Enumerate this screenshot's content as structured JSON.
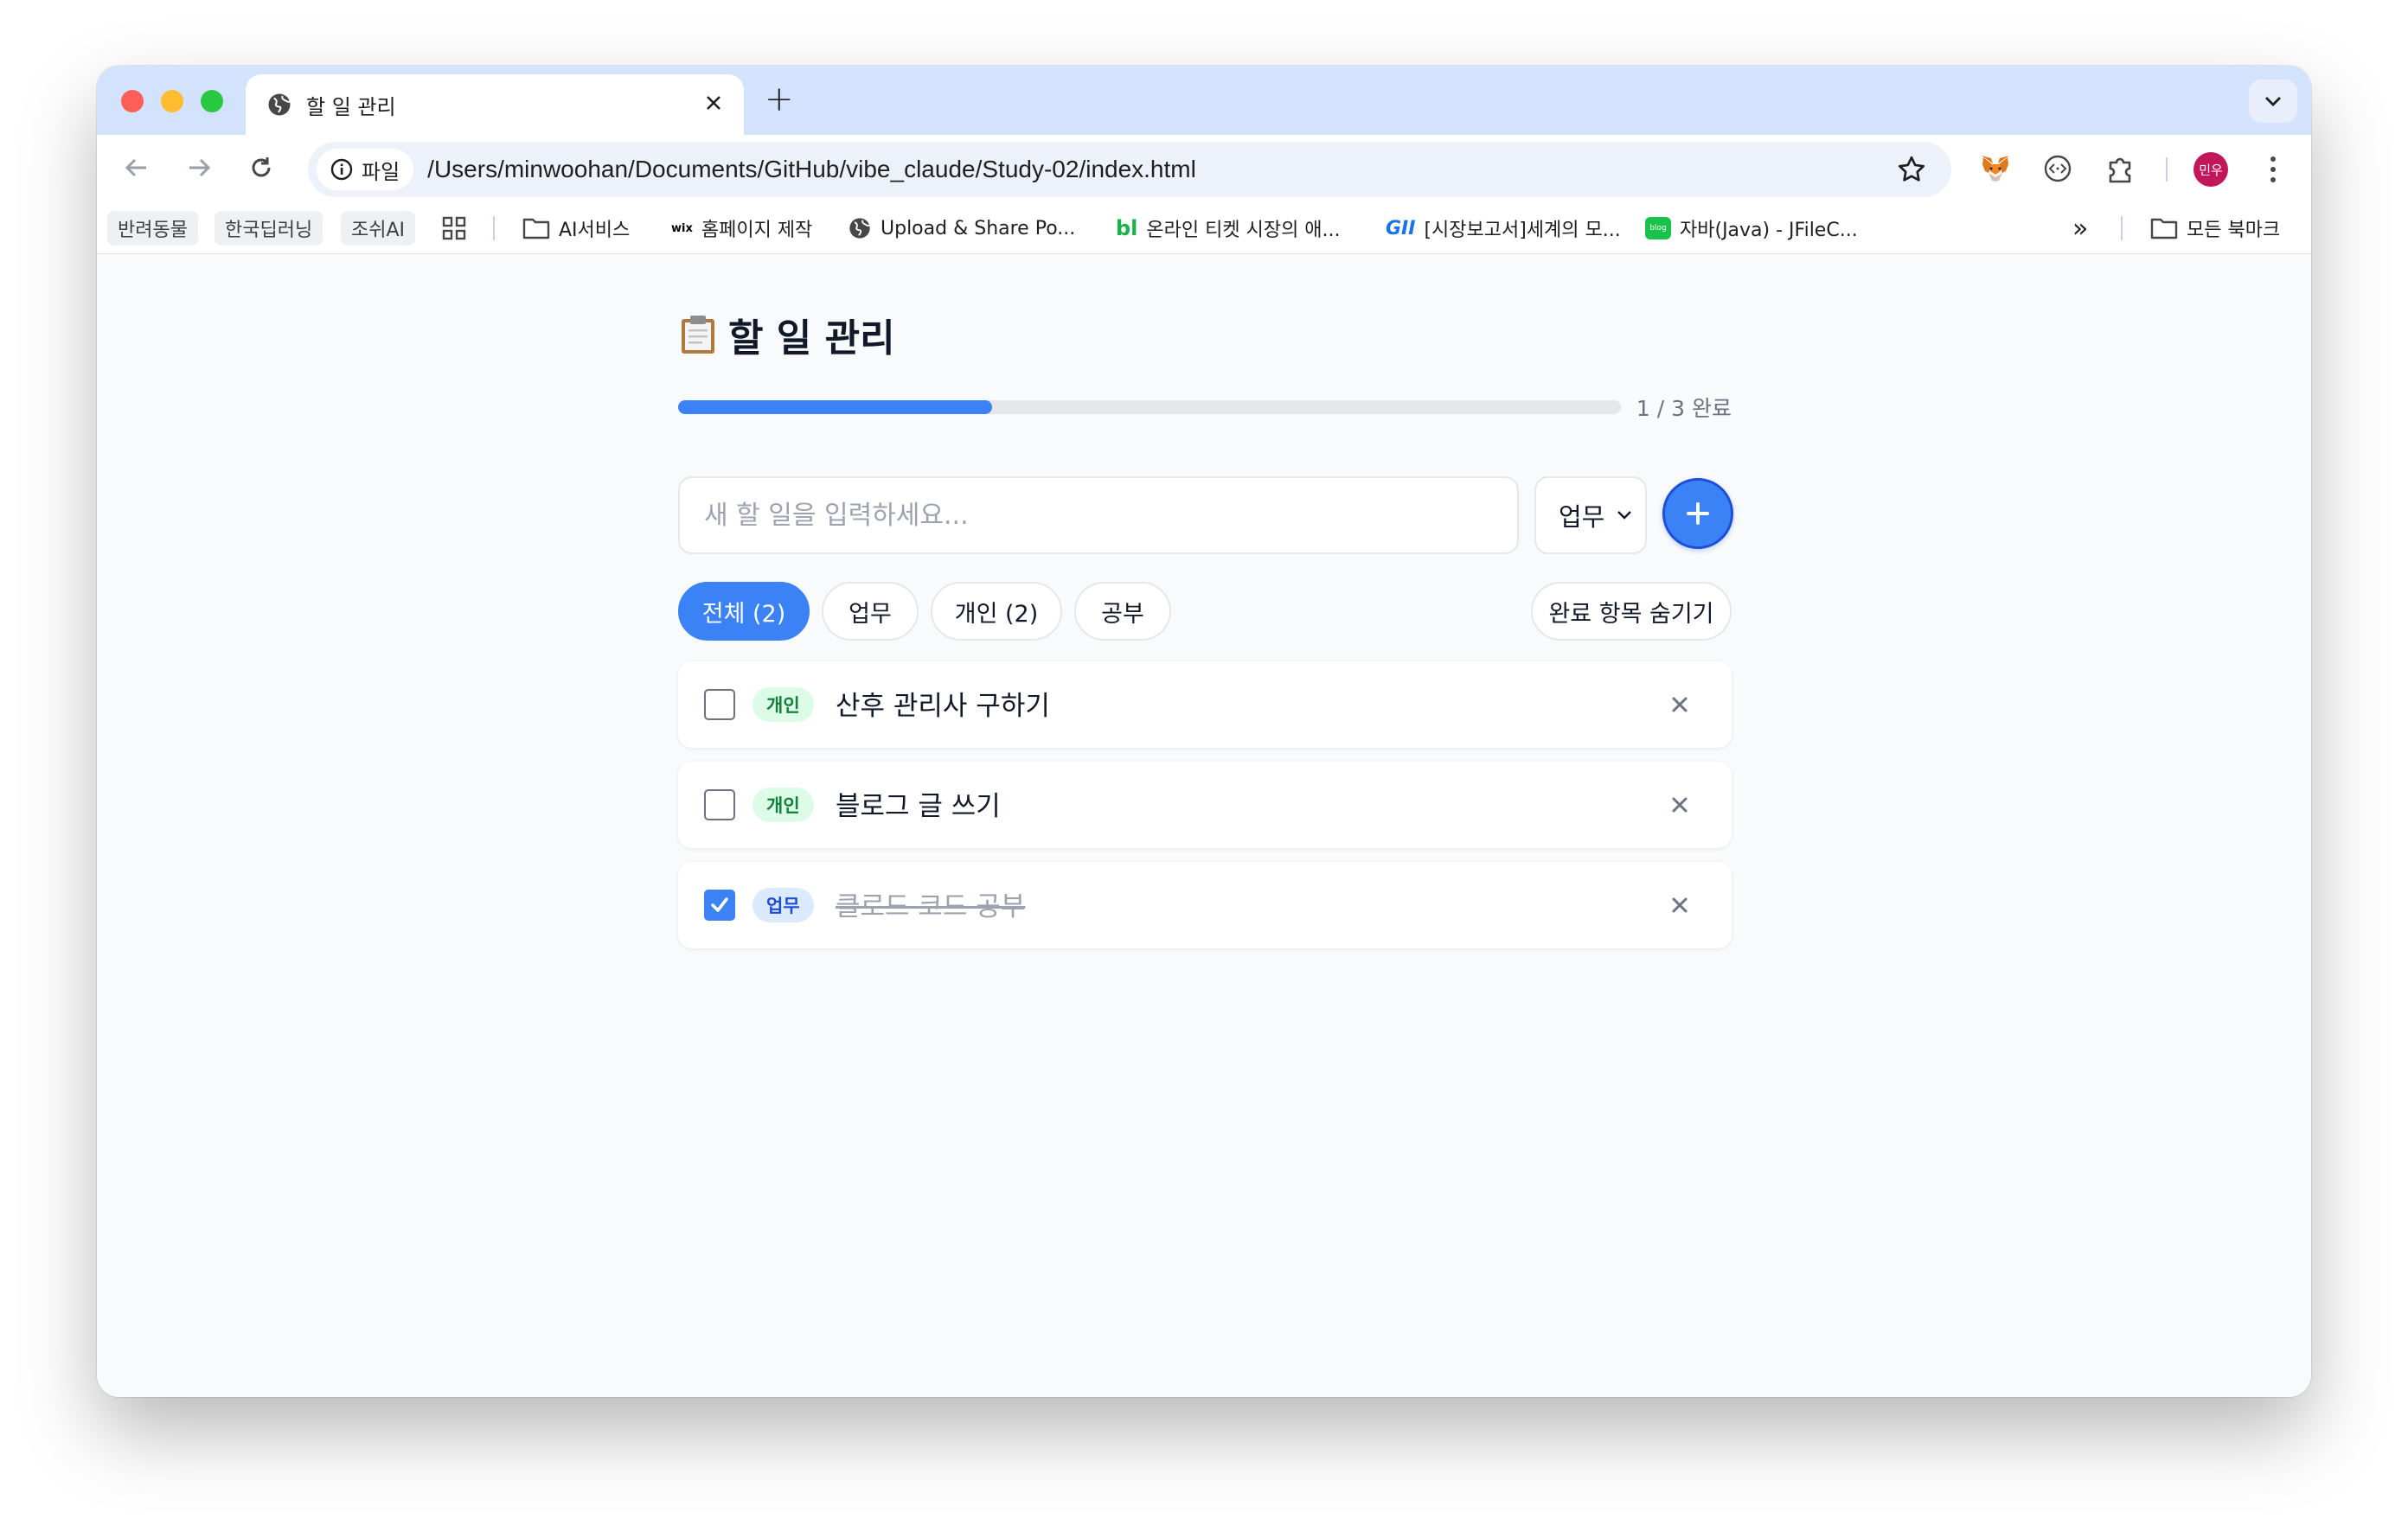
{
  "browser": {
    "tab_title": "할 일 관리",
    "new_tab_label": "+",
    "site_chip_label": "파일",
    "url": "/Users/minwoohan/Documents/GitHub/vibe_claude/Study-02/index.html",
    "profile_initials": "민우",
    "bookmarks": [
      {
        "label": "반려동물"
      },
      {
        "label": "한국딥러닝"
      },
      {
        "label": "조쉬AI"
      },
      {
        "label": "AI서비스"
      },
      {
        "label": "홈페이지 제작"
      },
      {
        "label": "Upload & Share Po..."
      },
      {
        "label": "온라인 티켓 시장의 애..."
      },
      {
        "label": "[시장보고서]세계의 모..."
      },
      {
        "label": "자바(Java) - JFileC..."
      }
    ],
    "all_bookmarks_label": "모든 북마크",
    "more_bookmarks_label": "»",
    "bookmark_favicon_labels": {
      "wix": "wix",
      "bl": "bl",
      "gii": "GII",
      "blog": "blog"
    }
  },
  "app": {
    "title": "할 일 관리",
    "progress": {
      "completed": 1,
      "total": 3,
      "fraction": 0.333,
      "label": "1 / 3 완료"
    },
    "input_placeholder": "새 할 일을 입력하세요...",
    "selected_category": "업무",
    "add_label": "+",
    "filters": [
      {
        "label": "전체 (2)",
        "active": true
      },
      {
        "label": "업무",
        "active": false
      },
      {
        "label": "개인 (2)",
        "active": false
      },
      {
        "label": "공부",
        "active": false
      }
    ],
    "hide_completed_label": "완료 항목 숨기기",
    "todos": [
      {
        "category": "개인",
        "text": "산후 관리사 구하기",
        "done": false
      },
      {
        "category": "개인",
        "text": "블로그 글 쓰기",
        "done": false
      },
      {
        "category": "업무",
        "text": "클로드 코드 공부",
        "done": true
      }
    ],
    "delete_label": "×"
  },
  "colors": {
    "accent": "#3b82f6",
    "personal_badge_bg": "#dcfce7",
    "personal_badge_fg": "#15803d",
    "work_badge_bg": "#dbeafe",
    "work_badge_fg": "#1d4ed8"
  }
}
